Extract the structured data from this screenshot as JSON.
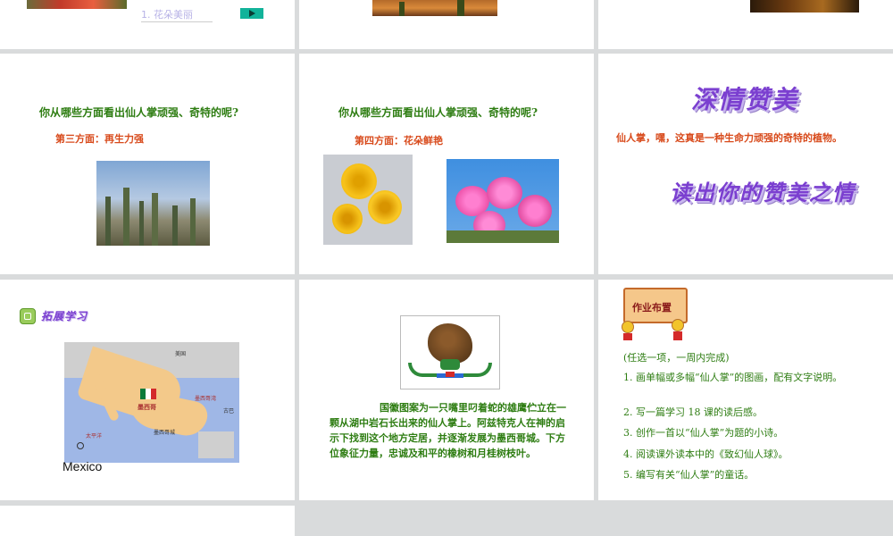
{
  "slides": {
    "s1": {
      "caption": "1. 花朵美丽"
    },
    "s4": {
      "question": "你从哪些方面看出仙人掌顽强、奇特的呢?",
      "aspect": "第三方面：再生力强"
    },
    "s5": {
      "question": "你从哪些方面看出仙人掌顽强、奇特的呢?",
      "aspect": "第四方面：花朵鲜艳"
    },
    "s6": {
      "title": "深情赞美",
      "body": "仙人掌，嘿，这真是一种生命力顽强的奇特的植物。",
      "subtitle": "读出你的赞美之情"
    },
    "s7": {
      "header": "拓展学习",
      "map_label": "Mexico",
      "map_labels": {
        "usa": "美国",
        "mexico": "墨西哥",
        "pacific": "太平洋",
        "gulf": "墨西哥湾",
        "cuba": "古巴",
        "mexico_city": "墨西哥城"
      }
    },
    "s8": {
      "body": "国徽图案为一只嘴里叼着蛇的雄鹰伫立在一颗从湖中岩石长出来的仙人掌上。阿兹特克人在神的启示下找到这个地方定居，并逐渐发展为墨西哥城。下方位象征力量，忠诚及和平的橡树和月桂树枝叶。"
    },
    "s9": {
      "sign": "作业布置",
      "intro": "(任选一项，一周内完成)",
      "items": [
        "1. 画单幅或多幅“仙人掌”的图画，配有文字说明。",
        "2. 写一篇学习 18 课的读后感。",
        "3. 创作一首以“仙人掌”为题的小诗。",
        "4. 阅读课外读本中的《致幻仙人球》。",
        "5. 编写有关“仙人掌”的童话。"
      ]
    }
  },
  "colors": {
    "green": "#2e7d12",
    "red": "#d84a1b",
    "purple": "#7b3fd0",
    "play": "#12b39a"
  }
}
